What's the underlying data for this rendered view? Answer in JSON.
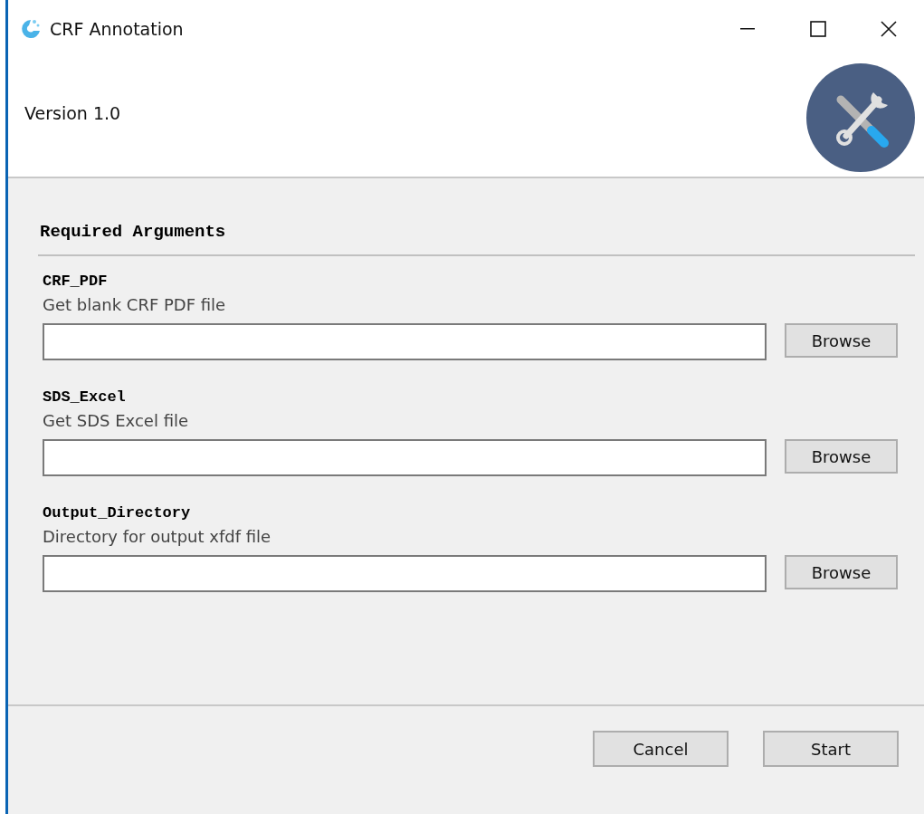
{
  "window": {
    "title": "CRF Annotation"
  },
  "header": {
    "version": "Version 1.0"
  },
  "section": {
    "title": "Required Arguments"
  },
  "arguments": [
    {
      "name": "CRF_PDF",
      "description": "Get blank CRF PDF file",
      "button": "Browse"
    },
    {
      "name": "SDS_Excel",
      "description": "Get SDS Excel file",
      "button": "Browse"
    },
    {
      "name": "Output_Directory",
      "description": "Directory for output xfdf file",
      "button": "Browse"
    }
  ],
  "buttons": [
    "Cancel",
    "Start"
  ]
}
